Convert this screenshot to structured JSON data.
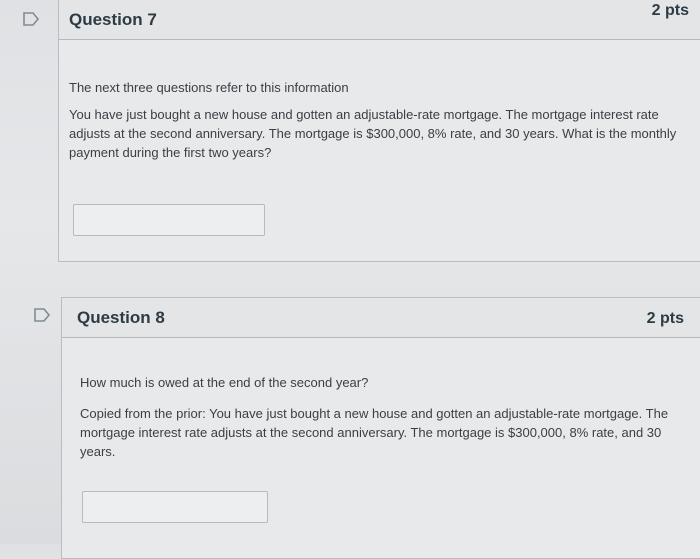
{
  "questions": [
    {
      "title": "Question 7",
      "points": "2 pts",
      "intro": "The next three questions refer to this information",
      "body": "You have just bought a new house and gotten an adjustable-rate mortgage. The mortgage interest rate adjusts at the second anniversary. The mortgage is $300,000, 8% rate, and 30 years. What is the monthly payment during the first two years?",
      "answer": ""
    },
    {
      "title": "Question 8",
      "points": "2 pts",
      "prompt": "How much is owed at the end of the second year?",
      "body": "Copied from the prior: You have just bought a new house and gotten an adjustable-rate mortgage. The mortgage interest rate adjusts at the second anniversary. The mortgage is $300,000, 8% rate, and 30 years.",
      "answer": ""
    }
  ],
  "icons": {
    "flag": "flag-outline-icon"
  },
  "colors": {
    "text": "#2d3b45",
    "border": "#b9bcc0",
    "flag": "#7f8c96"
  }
}
